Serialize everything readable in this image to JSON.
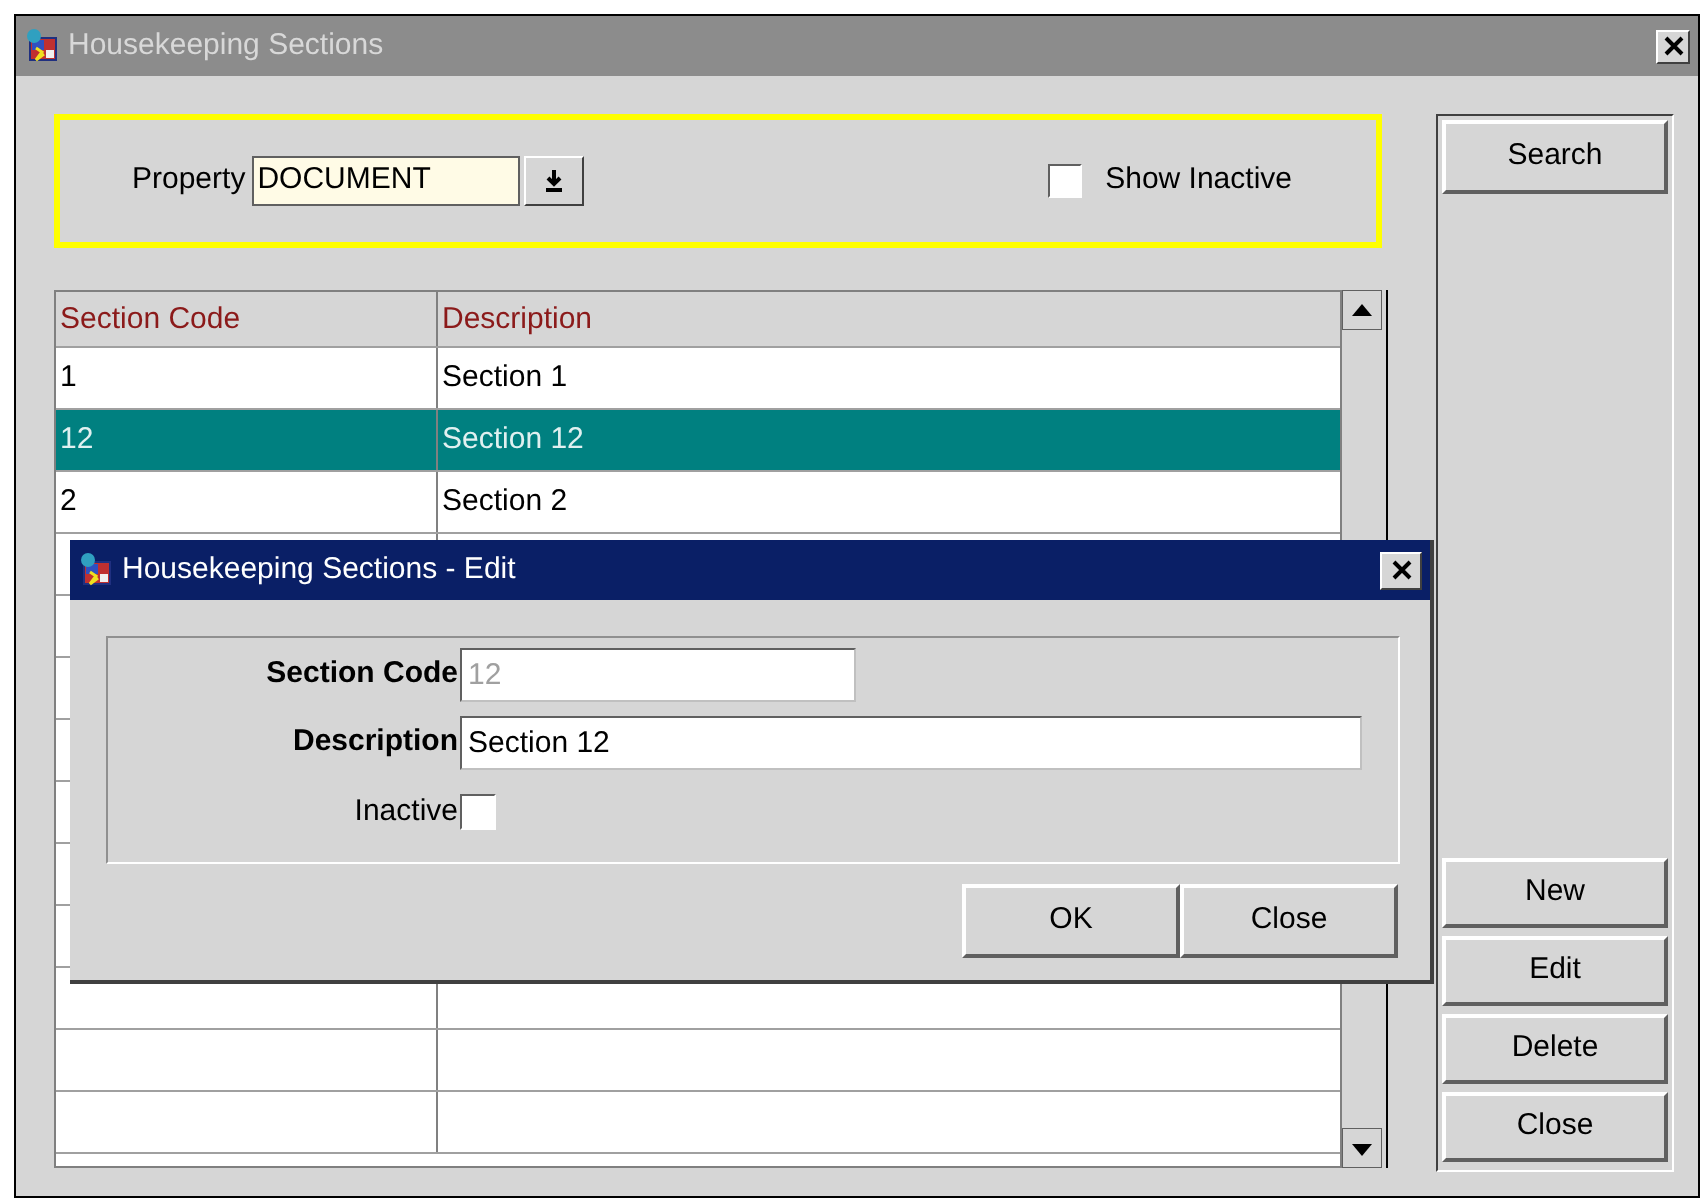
{
  "window": {
    "title": "Housekeeping Sections"
  },
  "filter": {
    "property_label": "Property",
    "property_value": "DOCUMENT",
    "show_inactive": {
      "label": "Show Inactive",
      "checked": false
    }
  },
  "table": {
    "columns": [
      "Section Code",
      "Description"
    ],
    "rows": [
      {
        "code": "1",
        "description": "Section 1",
        "selected": false
      },
      {
        "code": "12",
        "description": "Section 12",
        "selected": true
      },
      {
        "code": "2",
        "description": "Section 2",
        "selected": false
      }
    ]
  },
  "side_buttons": {
    "top": [
      "Search"
    ],
    "bottom": [
      "New",
      "Edit",
      "Delete",
      "Close"
    ]
  },
  "dialog": {
    "title": "Housekeeping Sections - Edit",
    "fields": [
      {
        "kind": "text",
        "label": "Section Code",
        "value": "12",
        "disabled": true
      },
      {
        "kind": "text",
        "label": "Description",
        "value": "Section 12",
        "disabled": false
      },
      {
        "kind": "checkbox",
        "label": "Inactive",
        "checked": false
      }
    ],
    "buttons": [
      "OK",
      "Close"
    ]
  }
}
